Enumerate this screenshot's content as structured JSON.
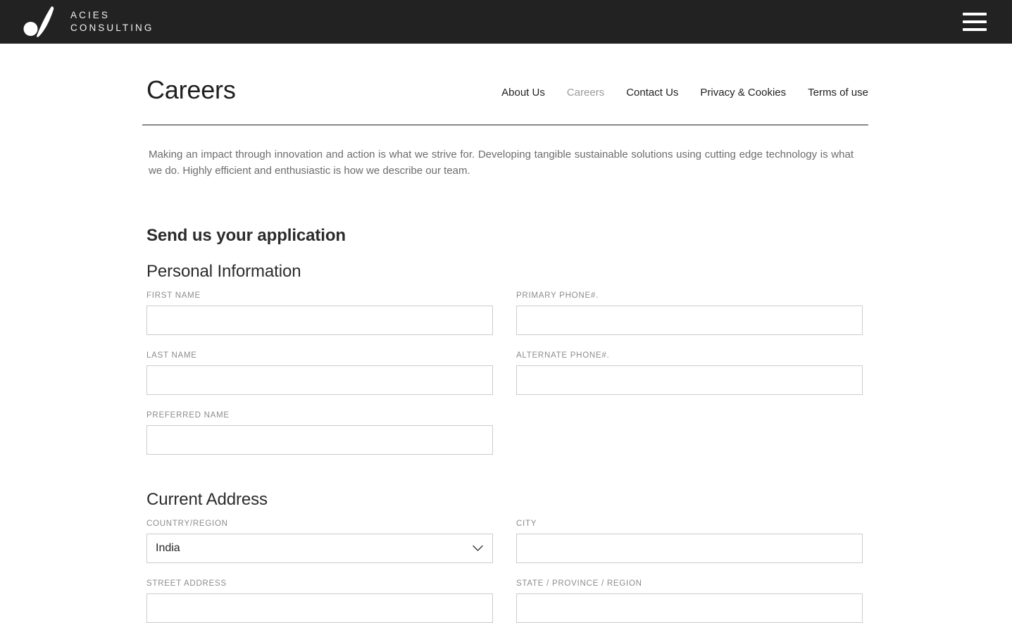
{
  "header": {
    "brand_line1": "ACIES",
    "brand_line2": "CONSULTING",
    "logo_icon": "acies-swoosh-logo",
    "menu_icon": "hamburger-menu-icon",
    "background_color": "#222222"
  },
  "page": {
    "title": "Careers",
    "nav": [
      {
        "label": "About Us",
        "active": false
      },
      {
        "label": "Careers",
        "active": true
      },
      {
        "label": "Contact Us",
        "active": false
      },
      {
        "label": "Privacy & Cookies",
        "active": false
      },
      {
        "label": "Terms of use",
        "active": false
      }
    ],
    "intro": "Making an impact through innovation and action is what we strive for. Developing tangible sustainable solutions using cutting edge technology is what we do. Highly efficient and enthusiastic is how we describe our team.",
    "section_title": "Send us your application"
  },
  "personal_information": {
    "heading": "Personal Information",
    "first_name": {
      "label": "FIRST NAME",
      "value": "",
      "placeholder": ""
    },
    "last_name": {
      "label": "LAST NAME",
      "value": "",
      "placeholder": ""
    },
    "preferred_name": {
      "label": "PREFERRED NAME",
      "value": "",
      "placeholder": ""
    },
    "primary_phone": {
      "label": "PRIMARY PHONE#.",
      "value": "",
      "placeholder": ""
    },
    "alternate_phone": {
      "label": "ALTERNATE PHONE#.",
      "value": "",
      "placeholder": ""
    }
  },
  "current_address": {
    "heading": "Current Address",
    "country_region": {
      "label": "COUNTRY/REGION",
      "value": "India",
      "options": [
        "India"
      ],
      "chevron_icon": "chevron-down-icon"
    },
    "street_address": {
      "label": "STREET ADDRESS",
      "value": "",
      "placeholder": ""
    },
    "city": {
      "label": "CITY",
      "value": "",
      "placeholder": ""
    },
    "state_province_region": {
      "label": "STATE / PROVINCE / REGION",
      "value": "",
      "placeholder": ""
    }
  },
  "colors": {
    "header_bg": "#222222",
    "text_primary": "#1f1f1f",
    "text_muted": "#8c8c8c",
    "body_text": "#6c6c6c",
    "nav_active": "#9a9a9a",
    "input_border": "#cccccc"
  }
}
